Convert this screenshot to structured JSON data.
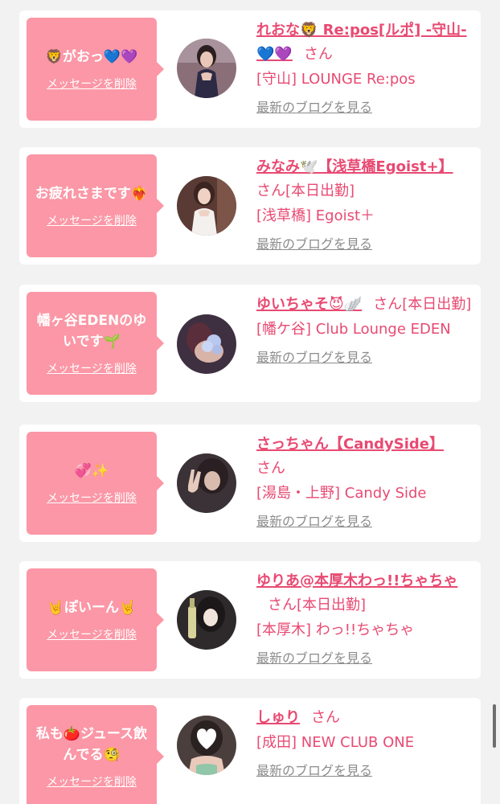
{
  "common": {
    "delete_label": "メッセージを削除",
    "san": "さん",
    "blog_label": "最新のブログを見る"
  },
  "colors": {
    "bubble": "#fb97a6",
    "name": "#e84a72",
    "blog_link": "#8c8c8c",
    "background": "#f2f2f2"
  },
  "messages": [
    {
      "message": "🦁がおっ💙💜",
      "name": "れおな🦁 Re:pos[ルポ] -守山-💙💜",
      "status": "",
      "shop": "[守山] LOUNGE Re:pos",
      "avatar_icon": "woman-portrait-dark-dress"
    },
    {
      "message": "お疲れさまです❤️‍🔥",
      "name": "みなみ🕊️【浅草橋Egoist+】",
      "status": "[本日出勤]",
      "shop": "[浅草橋] Egoist＋",
      "avatar_icon": "woman-portrait-white-dress"
    },
    {
      "message": "幡ヶ谷EDENのゆいです🌱",
      "name": "ゆいちゃそ😈🪽",
      "status": "[本日出勤]",
      "shop": "[幡ケ谷] Club Lounge EDEN",
      "avatar_icon": "woman-portrait-flower-sticker"
    },
    {
      "message": "💞✨",
      "name": "さっちゃん【CandySide】",
      "status": "",
      "shop": "[湯島・上野] Candy Side",
      "avatar_icon": "woman-portrait-peace-sign"
    },
    {
      "message": "🤘ぽいーん🤘",
      "name": "ゆりあ@本厚木わっ!!ちゃちゃ",
      "status": "[本日出勤]",
      "shop": "[本厚木] わっ!!ちゃちゃ",
      "avatar_icon": "woman-portrait-champagne"
    },
    {
      "message": "私も🍅ジュース飲んでる🧐",
      "name": "しゅり",
      "status": "",
      "shop": "[成田] NEW CLUB ONE",
      "avatar_icon": "woman-portrait-heart-sticker"
    }
  ]
}
